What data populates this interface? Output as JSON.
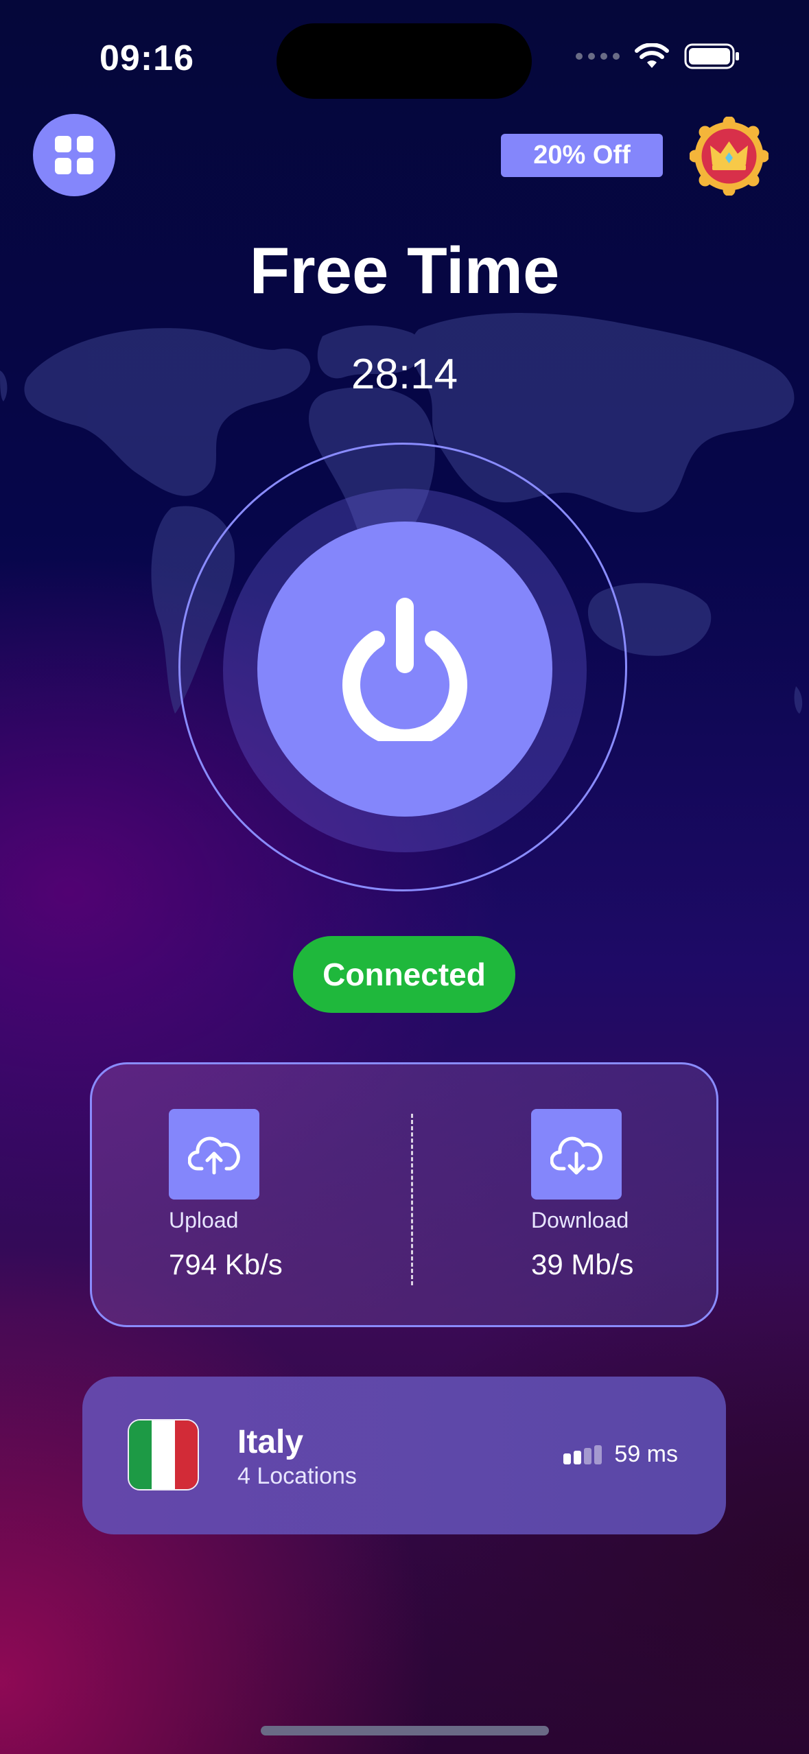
{
  "status_bar": {
    "time": "09:16"
  },
  "header": {
    "offer_label": "20% Off"
  },
  "main": {
    "title": "Free Time",
    "timer": "28:14",
    "status_label": "Connected"
  },
  "speed": {
    "upload_label": "Upload",
    "upload_value": "794 Kb/s",
    "download_label": "Download",
    "download_value": "39 Mb/s"
  },
  "location": {
    "name": "Italy",
    "subtitle": "4 Locations",
    "ping": "59 ms",
    "signal_level": 0.5
  },
  "colors": {
    "accent": "#8486fb",
    "connected": "#1fb83c",
    "flag_green": "#1d9a45",
    "flag_white": "#ffffff",
    "flag_red": "#d22b37"
  },
  "icons": {
    "menu": "grid-icon",
    "premium": "crown-icon",
    "power": "power-icon",
    "upload": "cloud-upload-icon",
    "download": "cloud-download-icon",
    "signal": "signal-bars-icon"
  }
}
